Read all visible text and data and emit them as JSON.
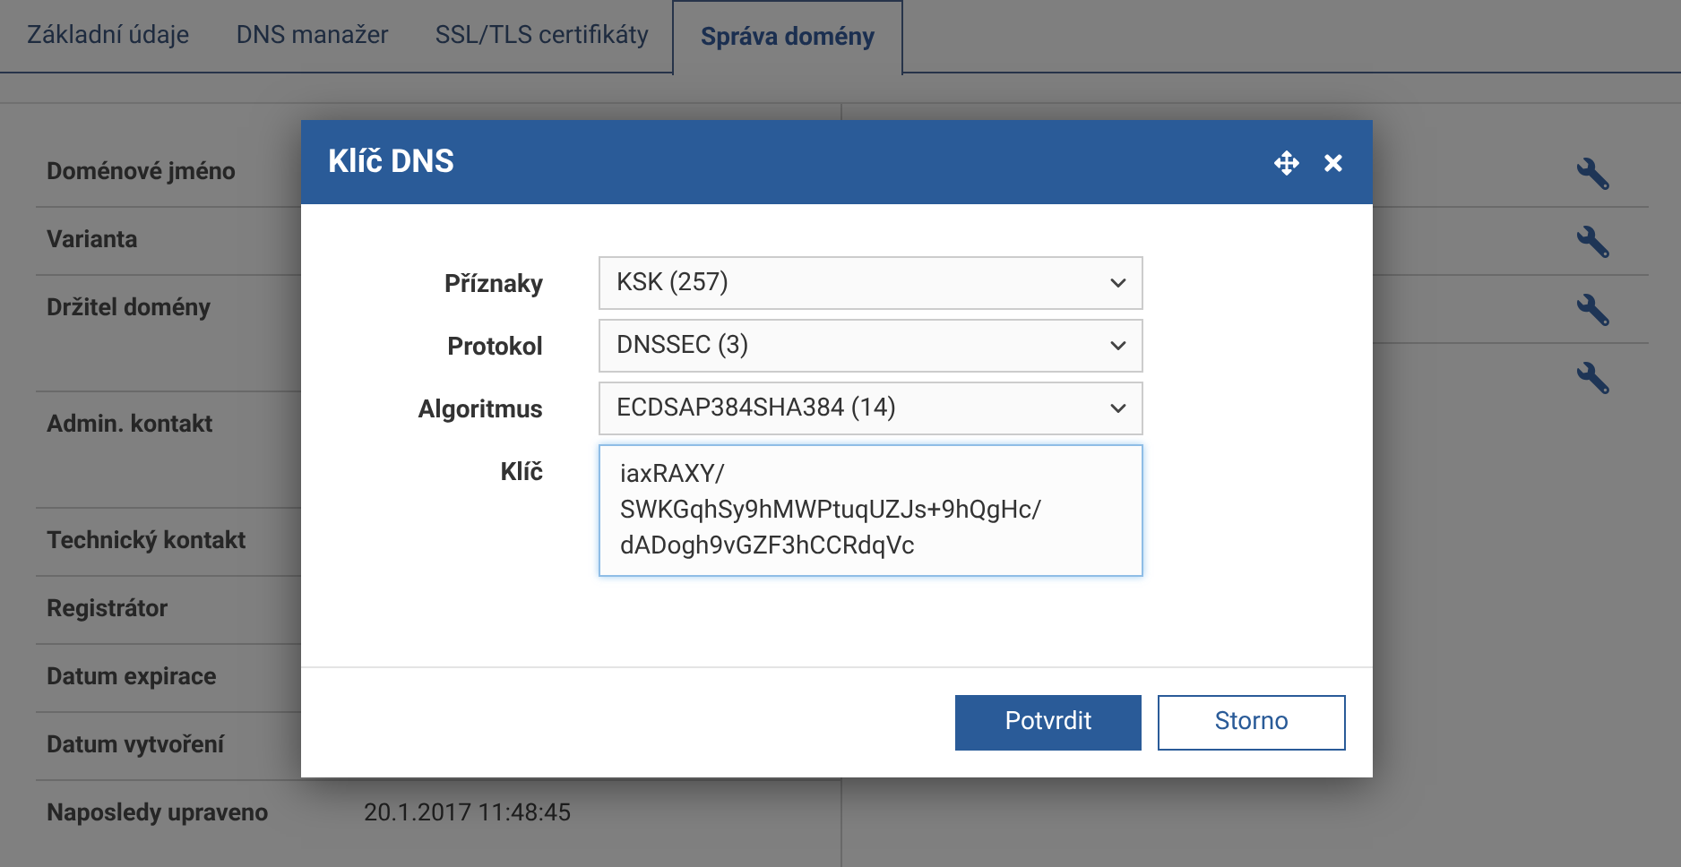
{
  "tabs": [
    {
      "label": "Základní údaje",
      "selected": false
    },
    {
      "label": "DNS manažer",
      "selected": false
    },
    {
      "label": "SSL/TLS certifikáty",
      "selected": false
    },
    {
      "label": "Správa domény",
      "selected": true
    }
  ],
  "details": [
    {
      "label": "Doménové jméno"
    },
    {
      "label": "Varianta"
    },
    {
      "label": "Držitel domény"
    },
    {
      "label": "Admin. kontakt"
    },
    {
      "label": "Technický kontakt"
    },
    {
      "label": "Registrátor"
    },
    {
      "label": "Datum expirace"
    },
    {
      "label": "Datum vytvoření"
    },
    {
      "label": "Naposledy upraveno",
      "value": "20.1.2017 11:48:45"
    }
  ],
  "dialog": {
    "title": "Klíč DNS",
    "fields": [
      {
        "label": "Příznaky",
        "kind": "select",
        "value": "KSK (257)"
      },
      {
        "label": "Protokol",
        "kind": "select",
        "value": "DNSSEC (3)"
      },
      {
        "label": "Algoritmus",
        "kind": "select",
        "value": "ECDSAP384SHA384 (14)"
      },
      {
        "label": "Klíč",
        "kind": "textarea",
        "value": "iaxRAXY/\nSWKGqhSy9hMWPtuqUZJs+9hQgHc/\ndADogh9vGZF3hCCRdqVc"
      }
    ],
    "buttons": [
      {
        "label": "Potvrdit",
        "kind": "primary"
      },
      {
        "label": "Storno",
        "kind": "secondary"
      }
    ]
  }
}
